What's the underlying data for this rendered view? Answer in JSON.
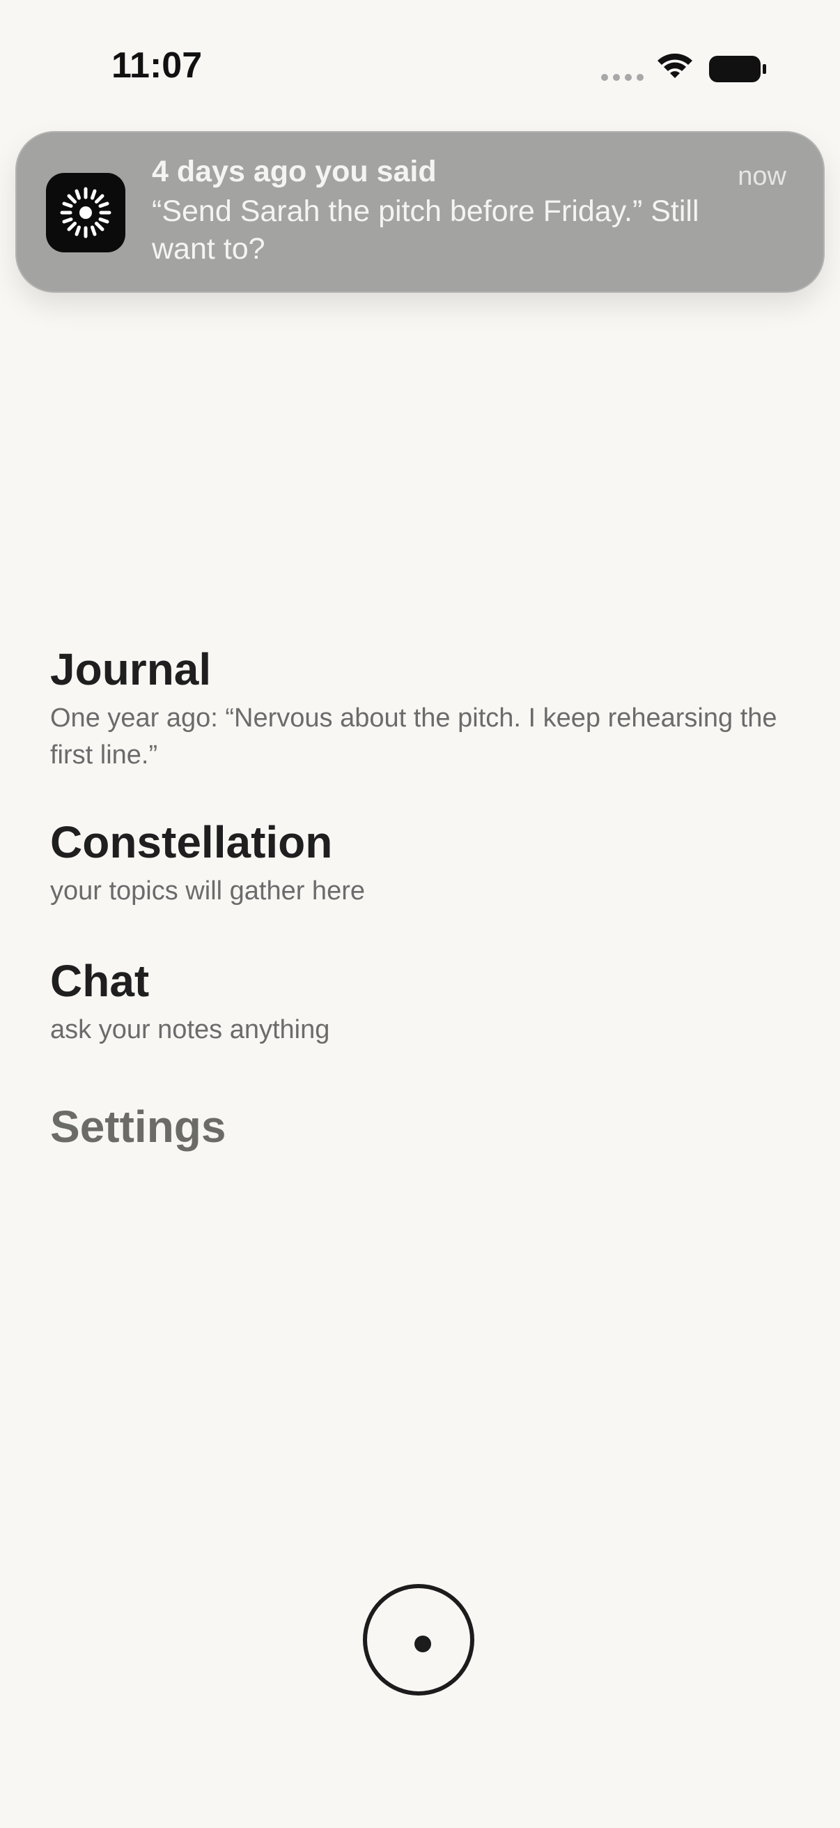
{
  "status_bar": {
    "time": "11:07",
    "icons": [
      "signal-dots-icon",
      "wifi-icon",
      "battery-icon"
    ]
  },
  "notification": {
    "app_icon": "sparkle-icon",
    "title": "4 days ago you said",
    "time": "now",
    "body": "“Send Sarah the pitch before Friday.” Still want to?",
    "background": "#a3a3a1"
  },
  "menu": {
    "journal": {
      "title": "Journal",
      "subtitle": "One year ago: “Nervous about the pitch. I keep rehearsing the first line.”"
    },
    "constellation": {
      "title": "Constellation",
      "subtitle": "your topics will gather here"
    },
    "chat": {
      "title": "Chat",
      "subtitle": "ask your notes anything"
    },
    "settings": {
      "title": "Settings"
    }
  },
  "record_button": {
    "icon": "record-icon"
  },
  "colors": {
    "background": "#f8f7f4",
    "text_primary": "#1f1f1f",
    "text_secondary": "#6b6b6b"
  }
}
